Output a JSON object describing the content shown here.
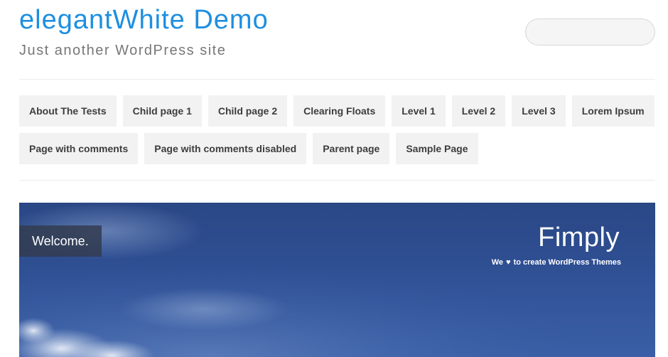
{
  "header": {
    "site_title": "elegantWhite Demo",
    "tagline": "Just another WordPress site",
    "search": {
      "value": "",
      "placeholder": ""
    }
  },
  "nav": {
    "items": [
      {
        "label": "About The Tests"
      },
      {
        "label": "Child page 1"
      },
      {
        "label": "Child page 2"
      },
      {
        "label": "Clearing Floats"
      },
      {
        "label": "Level 1"
      },
      {
        "label": "Level 2"
      },
      {
        "label": "Level 3"
      },
      {
        "label": "Lorem Ipsum"
      },
      {
        "label": "Page with comments"
      },
      {
        "label": "Page with comments disabled"
      },
      {
        "label": "Parent page"
      },
      {
        "label": "Sample Page"
      }
    ]
  },
  "slider": {
    "caption": "Welcome.",
    "brand_title": "Fimply",
    "brand_tagline_before": "We",
    "brand_tagline_icon": "heart-icon",
    "brand_tagline_after": "to create WordPress Themes"
  },
  "colors": {
    "title_blue": "#1e8fe0",
    "tagline_gray": "#777777",
    "nav_bg": "#f2f2f2",
    "nav_text": "#3d3d3d",
    "sky_blue": "#2f4f93"
  }
}
